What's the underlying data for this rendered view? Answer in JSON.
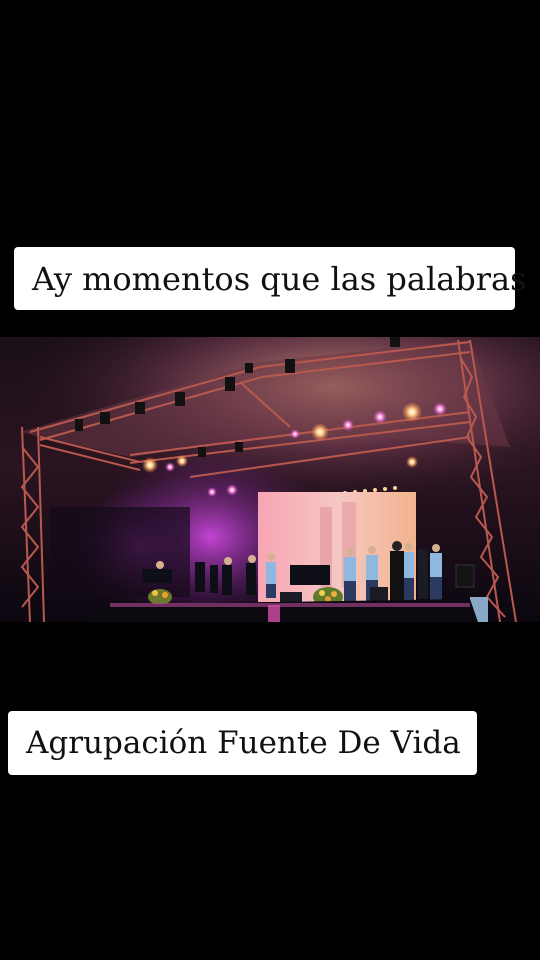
{
  "captions": {
    "top": "Ay momentos que las palabras",
    "bottom": "Agrupación Fuente De Vida"
  },
  "photo": {
    "subject": "concert-stage-photo"
  },
  "colors": {
    "background": "#000000",
    "caption_bg": "#ffffff",
    "caption_text": "#111111",
    "screen_glow": "#f3b3b0",
    "stage_light": "#ffb15c",
    "magenta_light": "#c43bd6"
  }
}
